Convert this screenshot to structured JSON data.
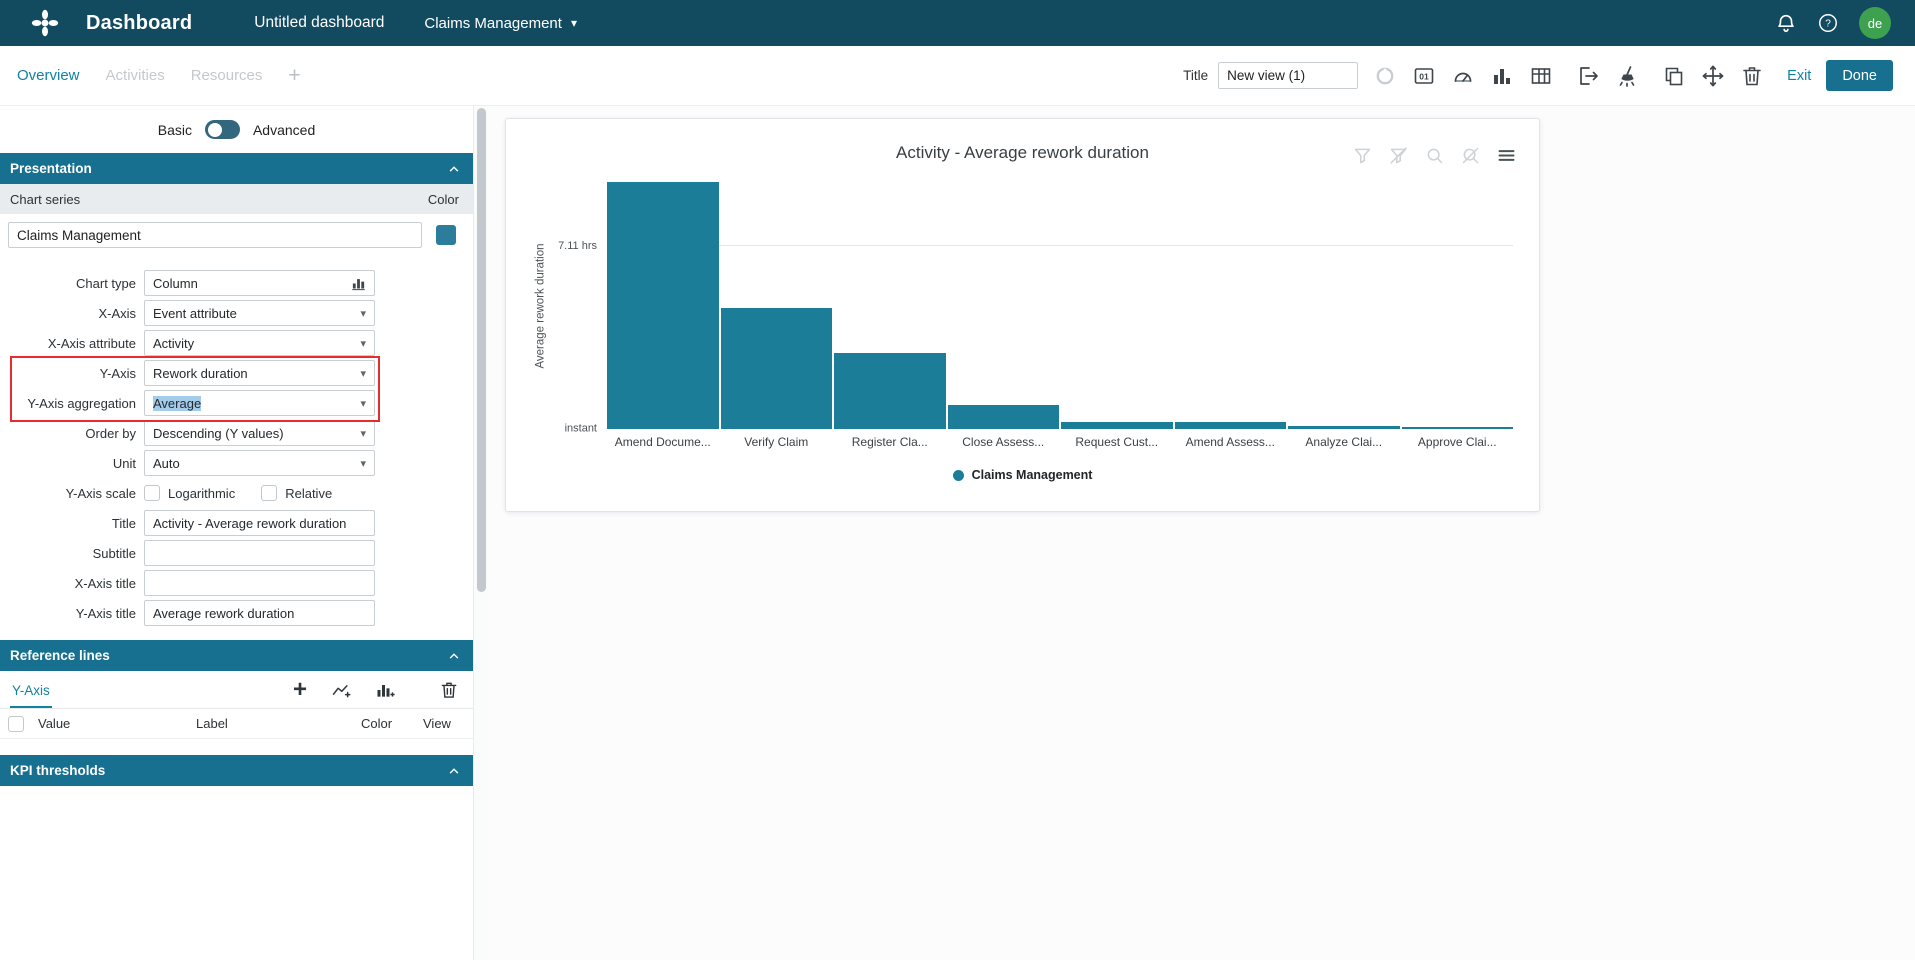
{
  "colors": {
    "topbar": "#124A5F",
    "accent": "#1182A2",
    "section_header": "#17708F",
    "bar": "#1C7D99",
    "avatar_bg": "#3EA150",
    "annotation_highlight": "#E82C2C",
    "text_selection": "#A3CCEB",
    "series_swatch": "#2C7C9B"
  },
  "glyphs": {
    "caret_down": "▾",
    "plus": "+",
    "question": "?"
  },
  "topbar": {
    "app_title": "Dashboard",
    "dashboard_name": "Untitled dashboard",
    "data_model": "Claims Management",
    "avatar_initials": "de"
  },
  "toolbar": {
    "tabs": [
      {
        "label": "Overview"
      },
      {
        "label": "Activities"
      },
      {
        "label": "Resources"
      }
    ],
    "add_tab_label": "+",
    "title_label": "Title",
    "title_value": "New view (1)",
    "exit_label": "Exit",
    "done_label": "Done"
  },
  "panel": {
    "mode": {
      "basic": "Basic",
      "advanced": "Advanced",
      "active": "Basic"
    },
    "sections": {
      "presentation": "Presentation",
      "reference_lines": "Reference lines",
      "kpi_thresholds": "KPI thresholds"
    },
    "chart_series_header": "Chart series",
    "color_header": "Color",
    "series_name": "Claims Management",
    "fields": [
      {
        "label": "Chart type",
        "value": "Column"
      },
      {
        "label": "X-Axis",
        "value": "Event attribute"
      },
      {
        "label": "X-Axis attribute",
        "value": "Activity"
      },
      {
        "label": "Y-Axis",
        "value": "Rework duration"
      },
      {
        "label": "Y-Axis aggregation",
        "value": "Average"
      },
      {
        "label": "Order by",
        "value": "Descending (Y values)"
      },
      {
        "label": "Unit",
        "value": "Auto"
      },
      {
        "label": "Y-Axis scale",
        "options": [
          "Logarithmic",
          "Relative"
        ]
      },
      {
        "label": "Title",
        "value": "Activity - Average rework duration"
      },
      {
        "label": "Subtitle",
        "value": ""
      },
      {
        "label": "X-Axis title",
        "value": ""
      },
      {
        "label": "Y-Axis title",
        "value": "Average rework duration"
      }
    ],
    "reference_lines": {
      "tab": "Y-Axis",
      "columns": [
        "Value",
        "Label",
        "Color",
        "View"
      ]
    }
  },
  "chart_data": {
    "type": "bar",
    "title": "Activity - Average rework duration",
    "xlabel": "",
    "ylabel": "Average rework duration",
    "unit": "hours",
    "ymax_hrs": 9.6,
    "y_axis_ticks": [
      {
        "label": "7.11 hrs",
        "value_hrs": 7.11
      },
      {
        "label": "instant",
        "value_hrs": 0
      }
    ],
    "grid": "single horizontal gridline at 7.11 hrs",
    "categories": [
      "Amend Docume...",
      "Verify Claim",
      "Register Cla...",
      "Close Assess...",
      "Request Cust...",
      "Amend Assess...",
      "Analyze Clai...",
      "Approve Clai..."
    ],
    "series": [
      {
        "name": "Claims Management",
        "color": "#1C7D99",
        "values_hrs": [
          9.6,
          4.7,
          2.95,
          0.93,
          0.28,
          0.26,
          0.12,
          0.06
        ]
      }
    ],
    "legend": {
      "position": "bottom",
      "entries": [
        {
          "label": "Claims Management",
          "color": "#1C7D99"
        }
      ]
    }
  }
}
